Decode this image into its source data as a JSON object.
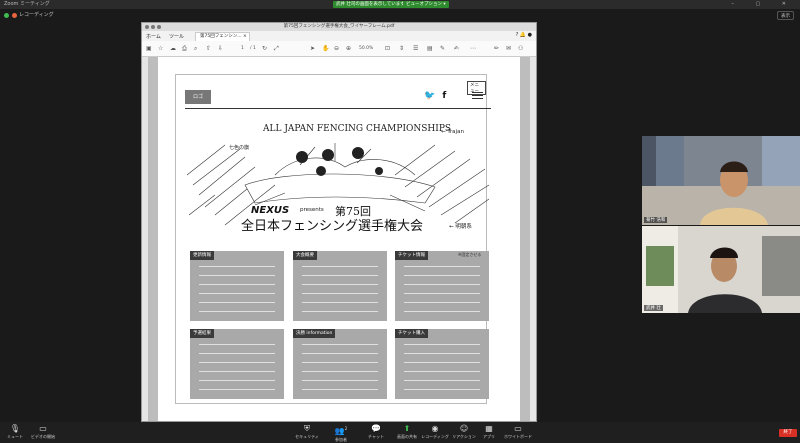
{
  "app": {
    "title": "Zoom ミーティング",
    "sharing_banner": "武井 壮司の画面を表示しています",
    "view_options": "ビューオプション ▾",
    "recording_label": "レコーディング",
    "view_button": "表示"
  },
  "pdf": {
    "window_title": "第75回フェンシング選手権大会_ワイヤーフレーム.pdf",
    "menu": [
      "ホーム",
      "ツール"
    ],
    "tab_label": "第75回フェンシン... ×",
    "page_current": "1",
    "page_total": "/ 1",
    "zoom": "50.0%"
  },
  "wireframe": {
    "logo": "ロゴ",
    "menu_label": "メニュー",
    "twitter": "🐦",
    "facebook": "f",
    "hero": {
      "championship": "ALL JAPAN FENCING CHAMPIONSHIPS",
      "trajan": "← Trajan",
      "nanairo": "七色の旗",
      "nexus": "NEXUS",
      "presents": "presents",
      "dai75": "第75回",
      "taikai": "全日本フェンシング選手権大会",
      "mincho": "← 明朝系"
    },
    "sections": [
      {
        "label": "更新情報"
      },
      {
        "label": "大会概要"
      },
      {
        "label": "チケット情報"
      },
      {
        "label": "予選結果"
      },
      {
        "label": "決勝 information"
      },
      {
        "label": "チケット購入"
      }
    ],
    "ticket_note": "※固定させる"
  },
  "participants": [
    {
      "name": "菊竹 浩和"
    },
    {
      "name": "武井 壮"
    }
  ],
  "toolbar": {
    "mute": "ミュート",
    "video": "ビデオの開始",
    "security": "セキュリティ",
    "participants": "参加者",
    "participants_count": "2",
    "chat": "チャット",
    "share": "画面の共有",
    "record": "レコーディング",
    "reactions": "リアクション",
    "apps": "アプリ",
    "whiteboard": "ホワイトボード",
    "end": "終了"
  }
}
